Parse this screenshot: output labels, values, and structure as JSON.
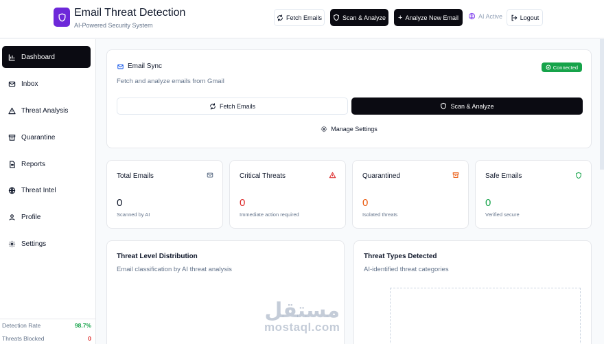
{
  "header": {
    "title": "Email Threat Detection",
    "subtitle": "AI-Powered Security System",
    "fetch_label": "Fetch Emails",
    "scan_label": "Scan & Analyze",
    "analyze_new_label": "Analyze New Email",
    "ai_status": "AI Active",
    "logout_label": "Logout"
  },
  "sidebar": {
    "items": [
      {
        "label": "Dashboard",
        "icon": "bar-chart-icon"
      },
      {
        "label": "Inbox",
        "icon": "mail-icon"
      },
      {
        "label": "Threat Analysis",
        "icon": "alert-triangle-icon"
      },
      {
        "label": "Quarantine",
        "icon": "archive-icon"
      },
      {
        "label": "Reports",
        "icon": "file-text-icon"
      },
      {
        "label": "Threat Intel",
        "icon": "globe-icon"
      },
      {
        "label": "Profile",
        "icon": "user-icon"
      },
      {
        "label": "Settings",
        "icon": "gear-icon"
      }
    ],
    "stats": [
      {
        "label": "Detection Rate",
        "value": "98.7%"
      },
      {
        "label": "Threats Blocked",
        "value": "0"
      }
    ]
  },
  "sync": {
    "title": "Email Sync",
    "subtitle": "Fetch and analyze emails from Gmail",
    "status": "Connected",
    "fetch_label": "Fetch Emails",
    "scan_label": "Scan & Analyze",
    "manage_label": "Manage Settings"
  },
  "stats": [
    {
      "label": "Total Emails",
      "value": "0",
      "note": "Scanned by AI",
      "icon": "mail-icon"
    },
    {
      "label": "Critical Threats",
      "value": "0",
      "note": "Immediate action required",
      "icon": "alert-triangle-icon"
    },
    {
      "label": "Quarantined",
      "value": "0",
      "note": "Isolated threats",
      "icon": "archive-icon"
    },
    {
      "label": "Safe Emails",
      "value": "0",
      "note": "Verified secure",
      "icon": "shield-icon"
    }
  ],
  "panels": {
    "threat_level": {
      "title": "Threat Level Distribution",
      "subtitle": "Email classification by AI threat analysis"
    },
    "threat_types": {
      "title": "Threat Types Detected",
      "subtitle": "AI-identified threat categories"
    }
  },
  "watermark": {
    "arabic": "مستقل",
    "latin": "mostaql.com"
  },
  "colors": {
    "brand": "#6d28d9",
    "primary_dark": "#0b0b12",
    "success": "#16a34a",
    "danger": "#dc2626",
    "warning": "#ea580c"
  }
}
